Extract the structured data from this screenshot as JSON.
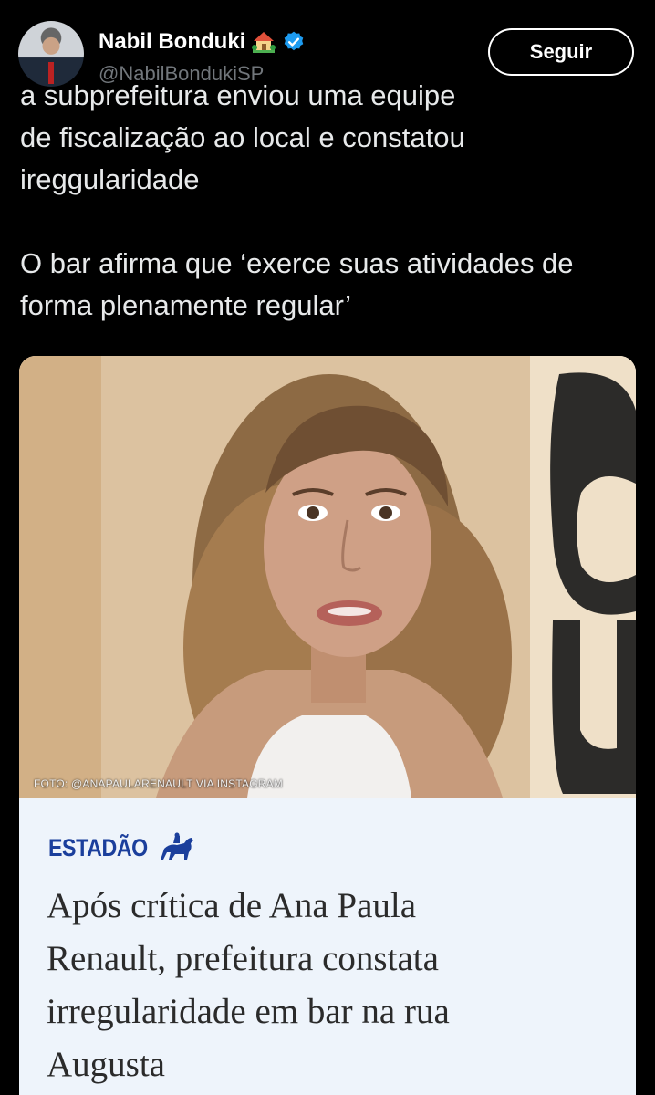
{
  "header": {
    "author_name": "Nabil Bonduki",
    "handle": "@NabilBondukiSP",
    "follow_label": "Seguir",
    "name_emoji_icon": "house-with-garden-icon",
    "verified_icon": "verified-badge-icon",
    "verified_color": "#1d9bf0"
  },
  "post": {
    "lines_first": [
      "a subprefeitura enviou uma equipe",
      "de fiscalização ao local e constatou",
      "ireggularidade"
    ],
    "lines_second": [
      "O bar afirma que ‘exerce suas atividades de",
      "forma plenamente regular’"
    ]
  },
  "media": {
    "photo_caption": "FOTO: @ANAPAULARENAULT VIA INSTAGRAM",
    "brand": "ESTADÃO",
    "brand_icon": "horse-rider-icon",
    "brand_color": "#1b3f9c",
    "headline_lines": [
      "Após crítica de Ana Paula",
      "Renault, prefeitura constata",
      "irregularidade em bar na rua",
      "Augusta"
    ]
  }
}
